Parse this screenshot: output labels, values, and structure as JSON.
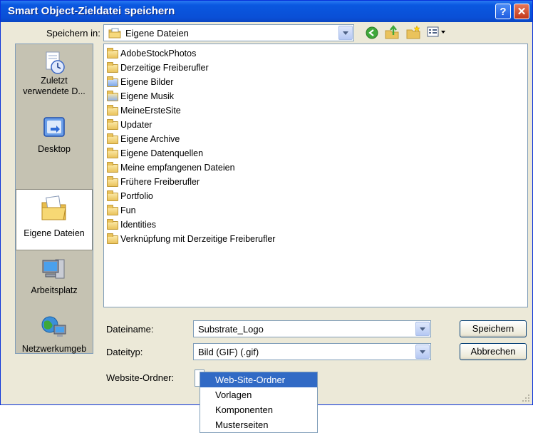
{
  "window": {
    "title": "Smart Object-Zieldatei speichern",
    "help_glyph": "?",
    "close_glyph": "✕"
  },
  "location": {
    "label": "Speichern in:",
    "value": "Eigene Dateien"
  },
  "sidebar": {
    "items": [
      {
        "label": "Zuletzt verwendete D...",
        "icon": "recent-documents-icon"
      },
      {
        "label": "Desktop",
        "icon": "desktop-icon"
      },
      {
        "label": "Eigene Dateien",
        "icon": "my-documents-icon",
        "selected": true
      },
      {
        "label": "Arbeitsplatz",
        "icon": "my-computer-icon"
      },
      {
        "label": "Netzwerkumgeb",
        "icon": "network-icon"
      }
    ]
  },
  "files": [
    {
      "name": "AdobeStockPhotos",
      "icon": "folder-icon"
    },
    {
      "name": "Derzeitige Freiberufler",
      "icon": "folder-icon"
    },
    {
      "name": "Eigene Bilder",
      "icon": "pictures-folder-icon"
    },
    {
      "name": "Eigene Musik",
      "icon": "music-folder-icon"
    },
    {
      "name": "MeineErsteSite",
      "icon": "folder-icon"
    },
    {
      "name": "Updater",
      "icon": "folder-icon"
    },
    {
      "name": "Eigene Archive",
      "icon": "folder-icon"
    },
    {
      "name": "Eigene Datenquellen",
      "icon": "folder-icon"
    },
    {
      "name": "Meine empfangenen Dateien",
      "icon": "folder-icon"
    },
    {
      "name": "Frühere Freiberufler",
      "icon": "folder-icon"
    },
    {
      "name": "Portfolio",
      "icon": "folder-icon"
    },
    {
      "name": "Fun",
      "icon": "folder-icon"
    },
    {
      "name": "Identities",
      "icon": "folder-icon"
    },
    {
      "name": "Verknüpfung mit Derzeitige Freiberufler",
      "icon": "shortcut-icon"
    }
  ],
  "filename": {
    "label": "Dateiname:",
    "value": "Substrate_Logo"
  },
  "filetype": {
    "label": "Dateityp:",
    "value": "Bild (GIF) (.gif)"
  },
  "website": {
    "label": "Website-Ordner:"
  },
  "buttons": {
    "save": "Speichern",
    "cancel": "Abbrechen"
  },
  "dropdown": {
    "items": [
      "Web-Site-Ordner",
      "Vorlagen",
      "Komponenten",
      "Musterseiten"
    ],
    "highlighted": "Web-Site-Ordner"
  }
}
